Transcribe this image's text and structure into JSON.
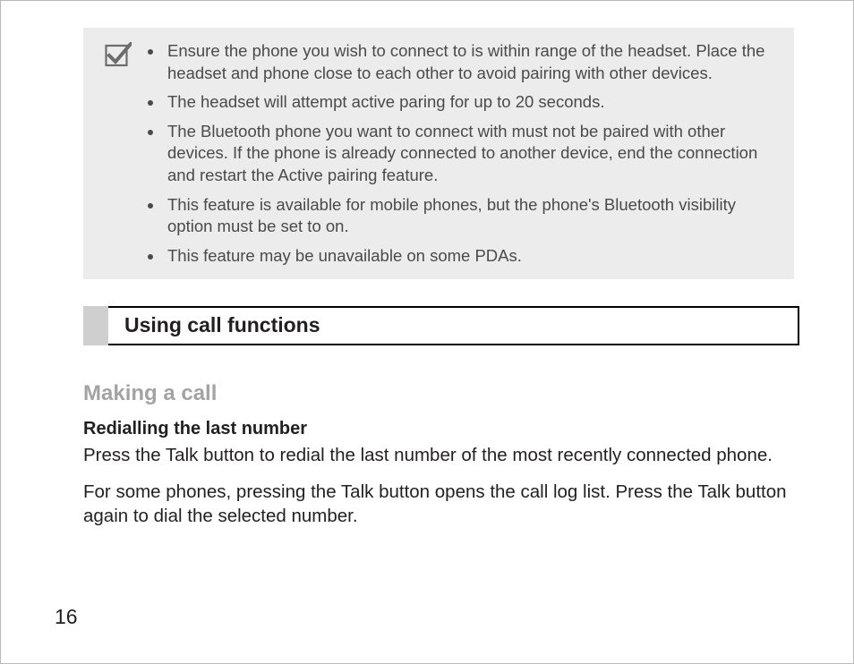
{
  "note": {
    "items": [
      "Ensure the phone you wish to connect to is within range of the headset. Place the headset and phone close to each other to avoid pairing with other devices.",
      "The headset will attempt active paring for up to 20 seconds.",
      "The Bluetooth phone you want to connect with must not be paired with other devices. If the phone is already connected to another device, end the connection and restart the Active pairing feature.",
      "This feature is available for mobile phones, but the phone's Bluetooth visibility option must be set to on.",
      "This feature may be unavailable on some PDAs."
    ]
  },
  "section_title": "Using call functions",
  "subhead": "Making a call",
  "smallhead": "Redialling the last number",
  "para1": "Press the Talk button to redial the last number of the most recently connected phone.",
  "para2": "For some phones, pressing the Talk button opens the call log list. Press the Talk button again to dial the selected number.",
  "page_number": "16"
}
